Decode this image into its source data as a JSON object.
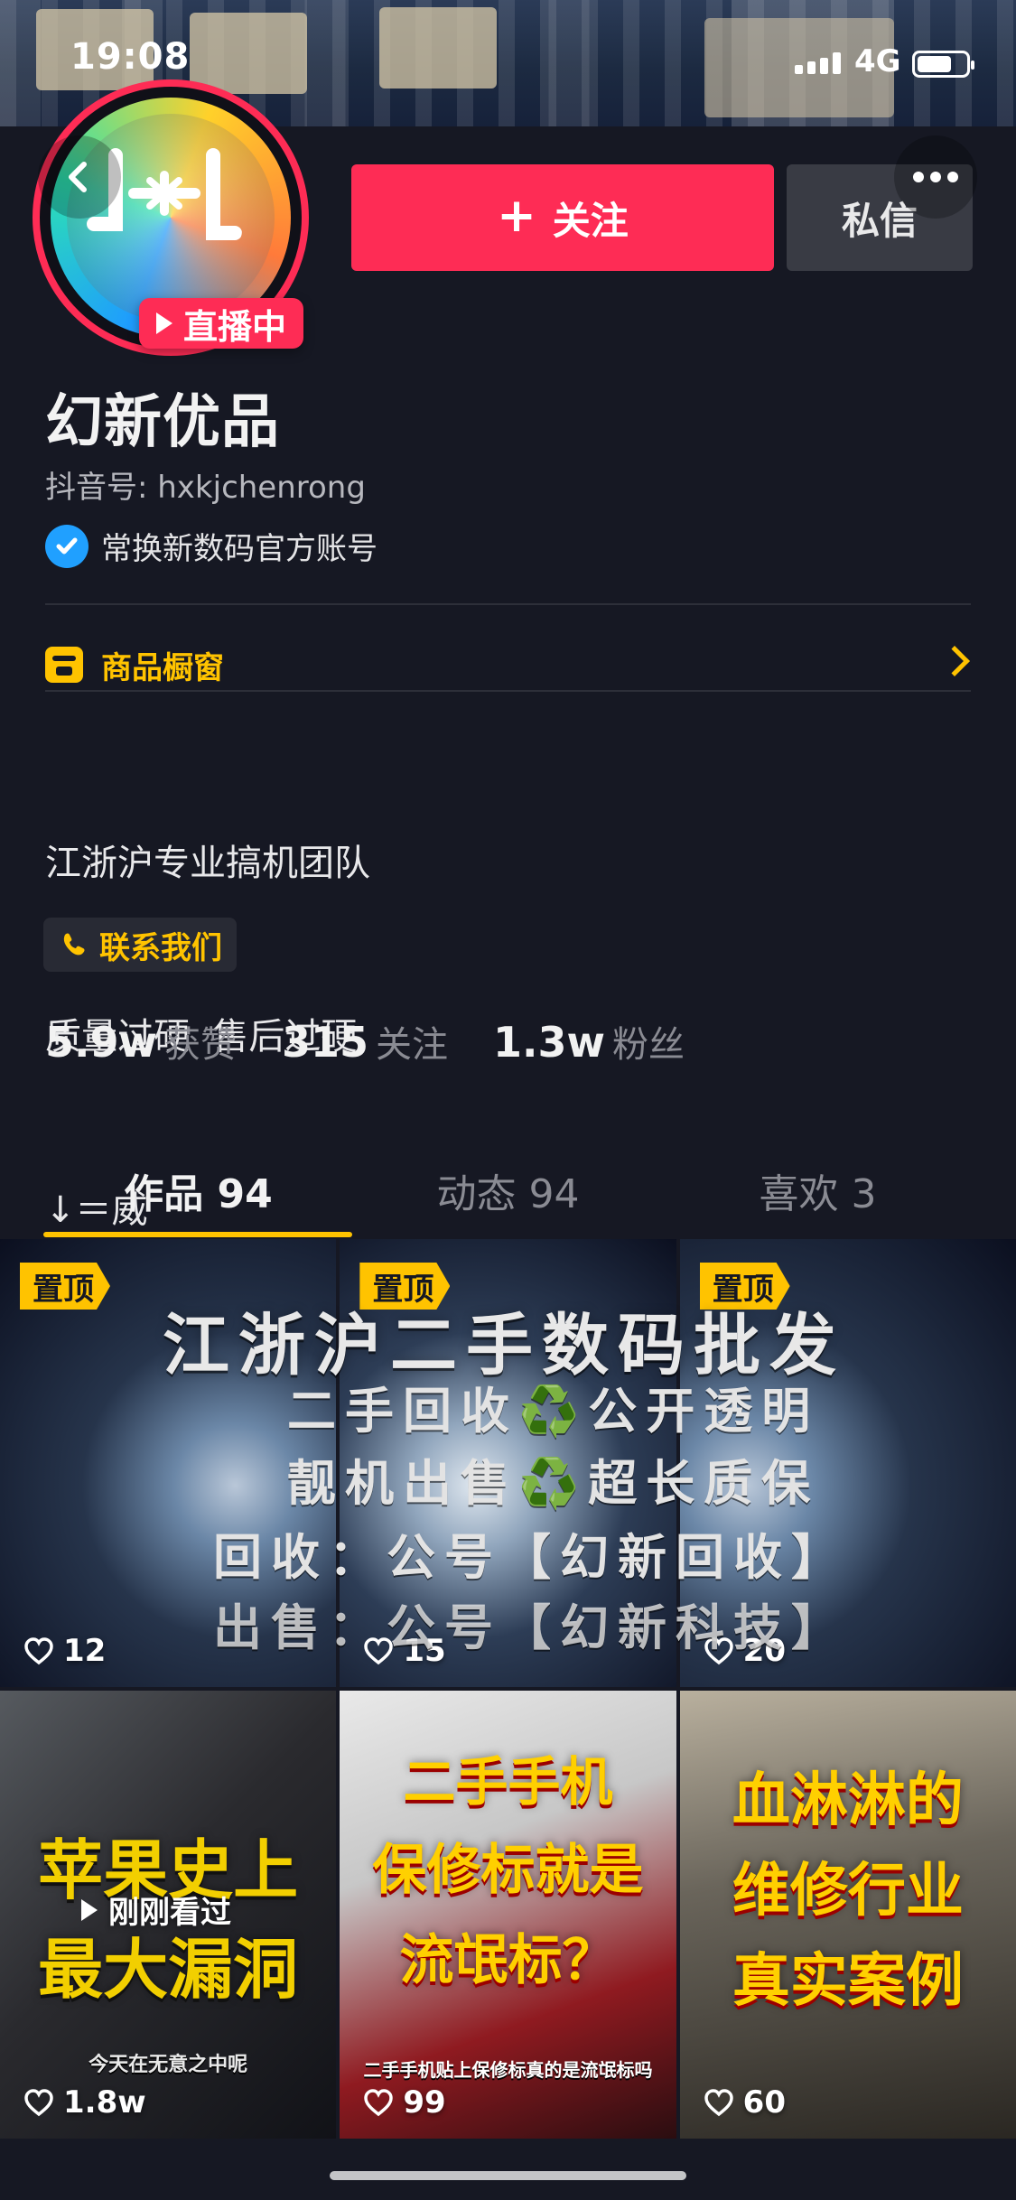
{
  "status_bar": {
    "time": "19:08",
    "network": "4G"
  },
  "header": {
    "live_badge": "直播中",
    "follow_label": "关注",
    "message_label": "私信"
  },
  "profile": {
    "name": "幻新优品",
    "douyin_id": "抖音号: hxkjchenrong",
    "verified_text": "常换新数码官方账号",
    "shop_label": "商品橱窗",
    "bio_lines": [
      "江浙沪专业搞机团队",
      "质量过硬  售后过硬",
      "↓＝威"
    ],
    "contact_label": "联系我们"
  },
  "stats": [
    {
      "value": "5.9w",
      "label": "获赞"
    },
    {
      "value": "315",
      "label": "关注"
    },
    {
      "value": "1.3w",
      "label": "粉丝"
    }
  ],
  "tabs": [
    {
      "label": "作品 94",
      "active": true
    },
    {
      "label": "动态 94",
      "active": false
    },
    {
      "label": "喜欢 3",
      "active": false
    }
  ],
  "pinned_overlay": {
    "title": "江浙沪二手数码批发",
    "line2": "二手回收♻️公开透明",
    "line3": "靓机出售♻️超长质保",
    "line4": "回收：公号【幻新回收】",
    "line5": "出售：公号【幻新科技】"
  },
  "videos": [
    {
      "pinned_label": "置顶",
      "likes": "12"
    },
    {
      "pinned_label": "置顶",
      "likes": "15"
    },
    {
      "pinned_label": "置顶",
      "likes": "20"
    },
    {
      "title_top": "苹果史上",
      "title_bottom": "最大漏洞",
      "seen_label": "刚刚看过",
      "subtitle": "今天在无意之中呢",
      "likes": "1.8w"
    },
    {
      "title_top": "二手手机",
      "title_mid": "保修标就是",
      "title_bottom": "流氓标？",
      "subtitle": "二手手机贴上保修标真的是流氓标吗",
      "likes": "99"
    },
    {
      "title_top": "血淋淋的",
      "title_mid": "维修行业",
      "title_bottom": "真实案例",
      "likes": "60"
    }
  ],
  "colors": {
    "background": "#161823",
    "accent_red": "#fe2c55",
    "accent_yellow": "#ffc300",
    "verified_blue": "#20a0ff"
  }
}
